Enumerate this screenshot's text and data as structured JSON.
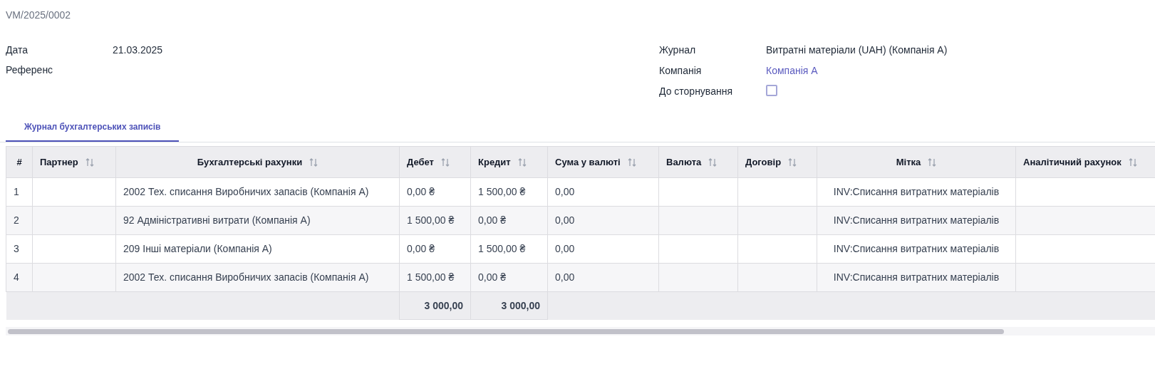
{
  "record": {
    "name": "VM/2025/0002"
  },
  "fields_left": [
    {
      "label": "Дата",
      "value": "21.03.2025"
    },
    {
      "label": "Референс"
    }
  ],
  "fields_right": [
    {
      "label": "Журнал",
      "value": "Витратні матеріали (UAH) (Компанія A)",
      "kind": "text"
    },
    {
      "label": "Компанія",
      "value": "Компанія A",
      "kind": "link"
    },
    {
      "label": "До сторнування",
      "kind": "checkbox",
      "checked": false
    }
  ],
  "tabs": [
    {
      "label": "Журнал бухгалтерських записів",
      "selected": true
    }
  ],
  "table": {
    "columns": [
      {
        "label": "#",
        "sortable": false
      },
      {
        "label": "Партнер",
        "sortable": true
      },
      {
        "label": "Бухгалтерські рахунки",
        "sortable": true
      },
      {
        "label": "Дебет",
        "sortable": true
      },
      {
        "label": "Кредит",
        "sortable": true
      },
      {
        "label": "Сума у валюті",
        "sortable": true
      },
      {
        "label": "Валюта",
        "sortable": true
      },
      {
        "label": "Договір",
        "sortable": true
      },
      {
        "label": "Мітка",
        "sortable": true
      },
      {
        "label": "Аналітичний рахунок",
        "sortable": true
      }
    ],
    "rows": [
      {
        "number": "1",
        "account": "2002 Тех. списання Виробничих запасів (Компанія A)",
        "debit": "0,00 ₴",
        "credit": "1 500,00 ₴",
        "amount_currency": "0,00",
        "label": "INV:Списання витратних матеріалів"
      },
      {
        "number": "2",
        "account": "92 Адміністративні витрати (Компанія A)",
        "debit": "1 500,00 ₴",
        "credit": "0,00 ₴",
        "amount_currency": "0,00",
        "label": "INV:Списання витратних матеріалів"
      },
      {
        "number": "3",
        "account": "209 Інші матеріали (Компанія A)",
        "debit": "0,00 ₴",
        "credit": "1 500,00 ₴",
        "amount_currency": "0,00",
        "label": "INV:Списання витратних матеріалів"
      },
      {
        "number": "4",
        "account": "2002 Тех. списання Виробничих запасів (Компанія A)",
        "debit": "1 500,00 ₴",
        "credit": "0,00 ₴",
        "amount_currency": "0,00",
        "label": "INV:Списання витратних матеріалів"
      }
    ],
    "totals": {
      "debit": "3 000,00",
      "credit": "3 000,00"
    }
  }
}
